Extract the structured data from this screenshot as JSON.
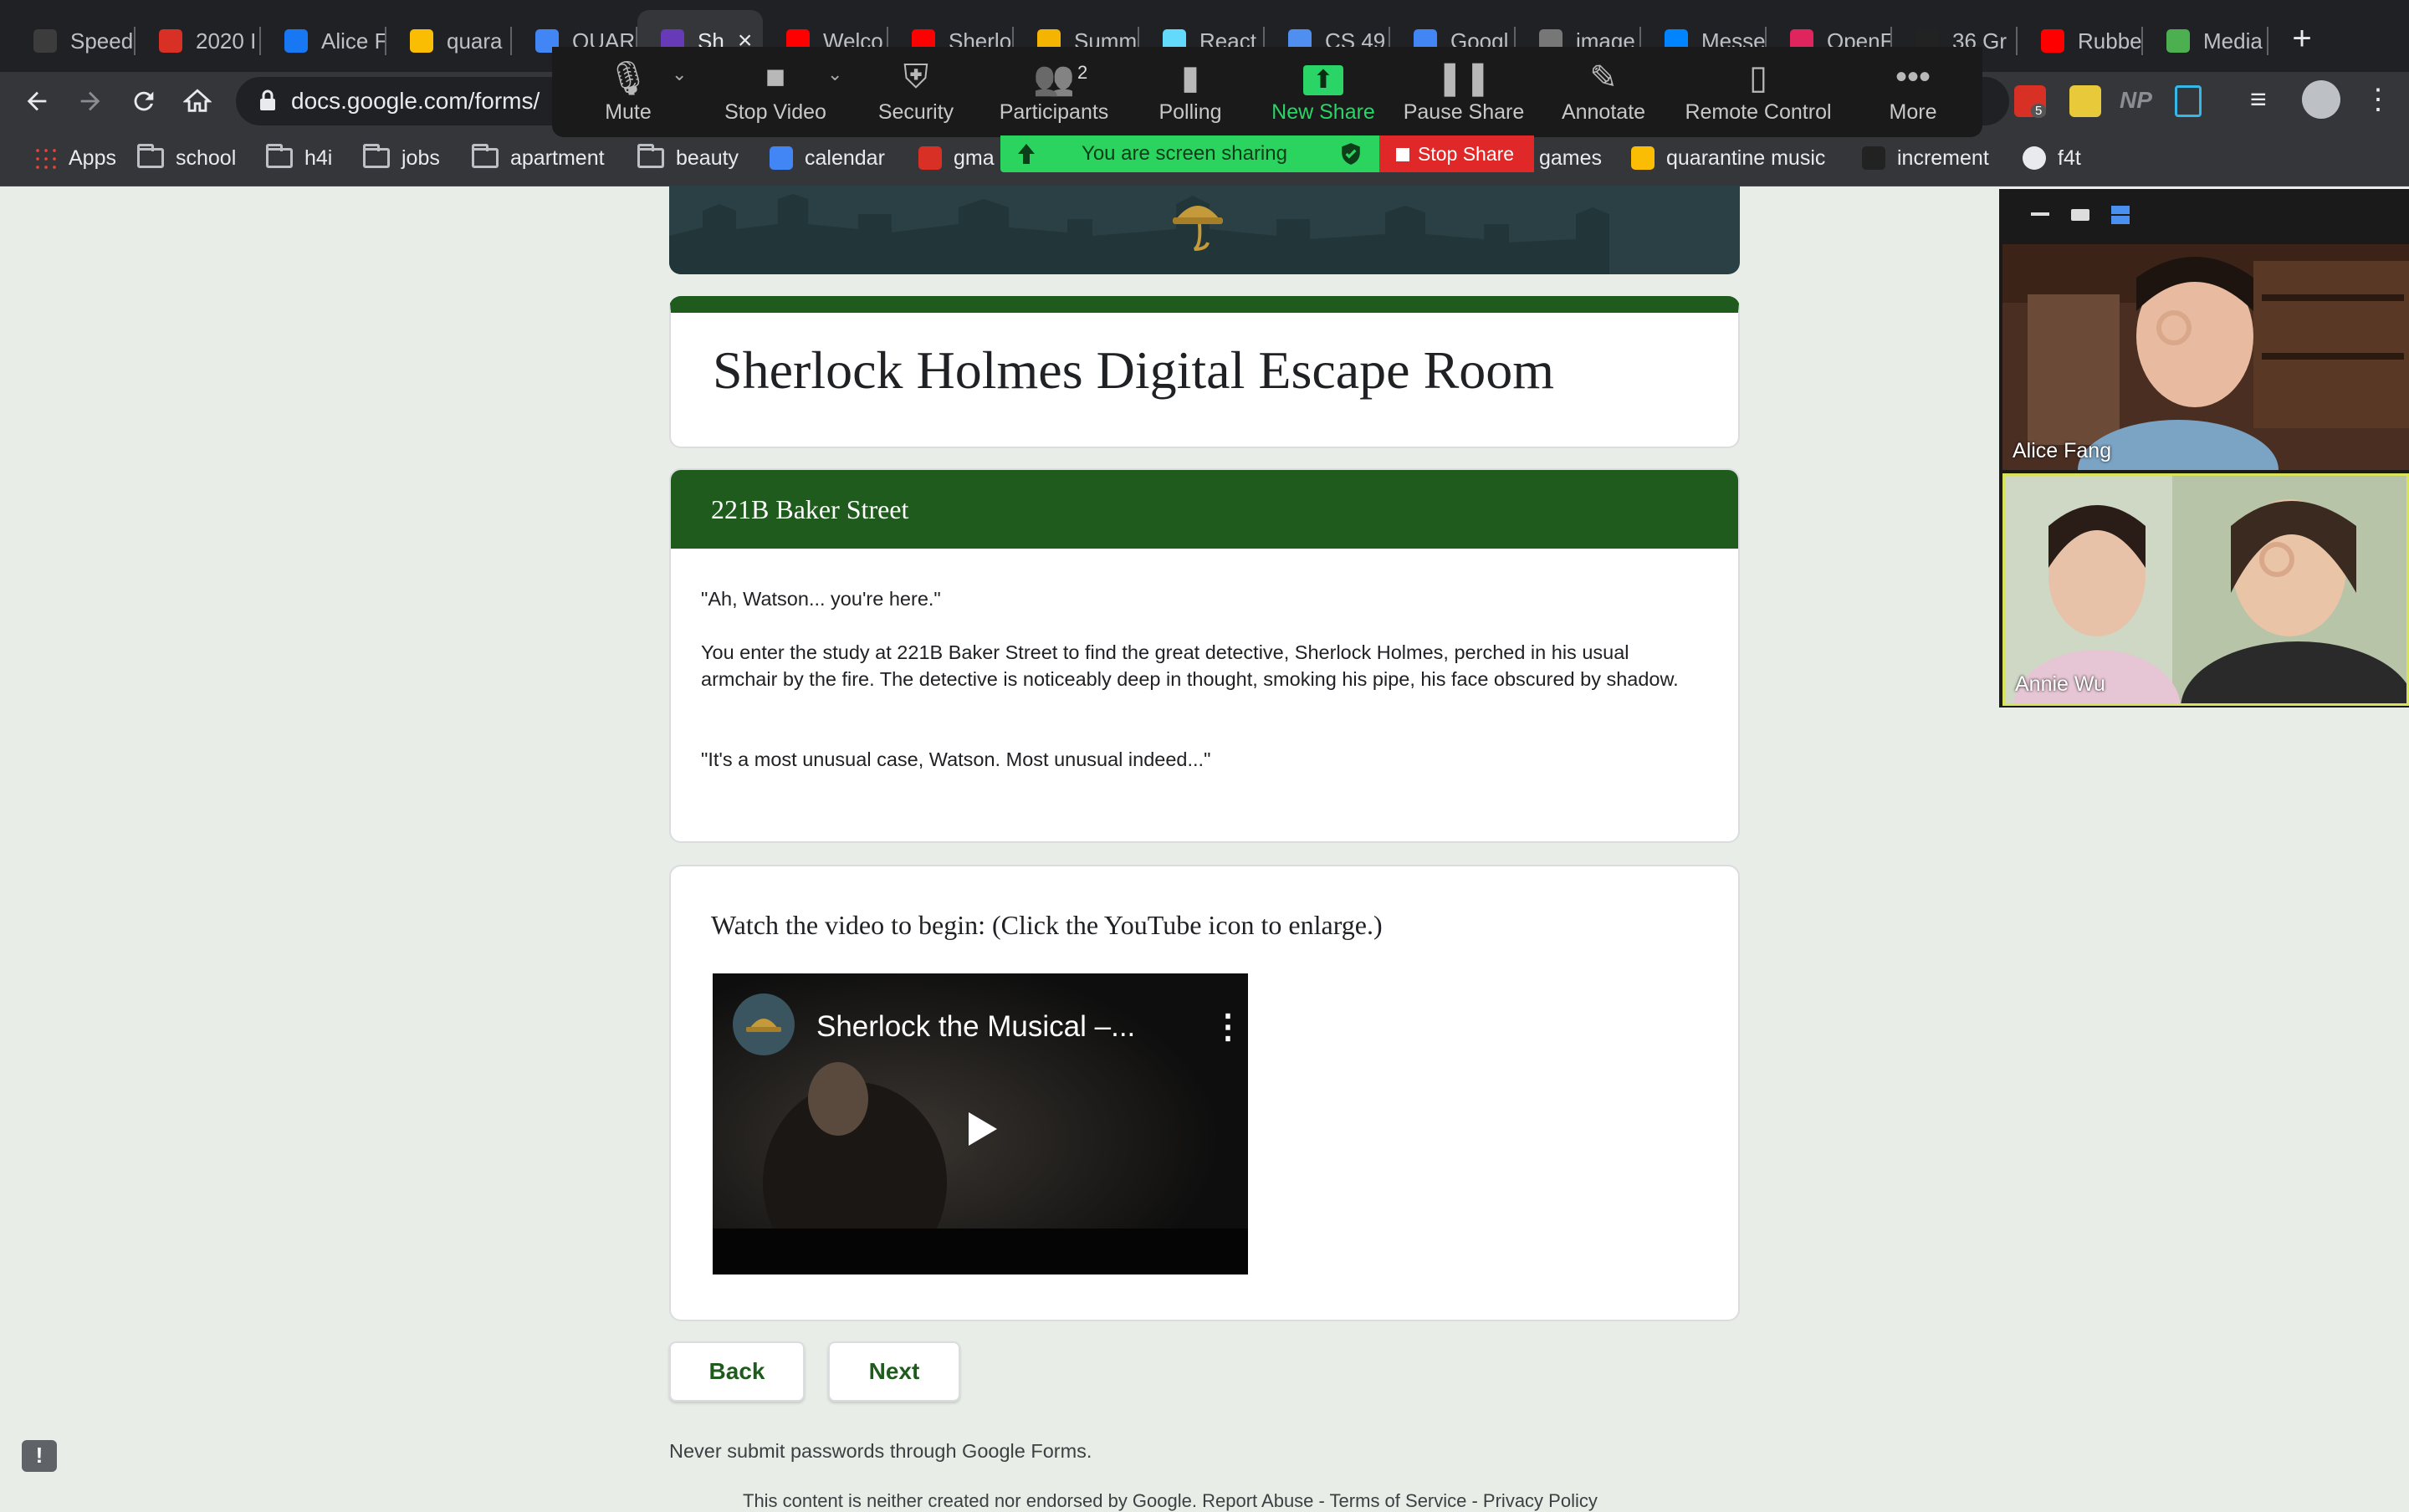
{
  "browser": {
    "tabs": [
      {
        "label": "Speed",
        "icon": "speedtest-icon",
        "color": "#3c3c3c"
      },
      {
        "label": "2020 I",
        "icon": "gmail-icon",
        "color": "#d93025"
      },
      {
        "label": "Alice F",
        "icon": "facebook-icon",
        "color": "#1877f2"
      },
      {
        "label": "quara",
        "icon": "drive-icon",
        "color": "#fbbc04"
      },
      {
        "label": "QUAR",
        "icon": "docs-icon",
        "color": "#4285f4"
      },
      {
        "label": "Sh",
        "icon": "forms-icon",
        "color": "#673ab7",
        "active": true
      },
      {
        "label": "Welco",
        "icon": "youtube-icon",
        "color": "#ff0000"
      },
      {
        "label": "Sherlo",
        "icon": "youtube-icon",
        "color": "#ff0000"
      },
      {
        "label": "Summ",
        "icon": "slides-icon",
        "color": "#f4b400"
      },
      {
        "label": "React",
        "icon": "react-icon",
        "color": "#61dafb"
      },
      {
        "label": "CS 49",
        "icon": "link-icon",
        "color": "#4f8ff0"
      },
      {
        "label": "Googl",
        "icon": "calendar-icon",
        "color": "#4285f4"
      },
      {
        "label": "image",
        "icon": "google-icon",
        "color": "#777777"
      },
      {
        "label": "Messe",
        "icon": "messenger-icon",
        "color": "#0084ff"
      },
      {
        "label": "OpenF",
        "icon": "openframeworks-icon",
        "color": "#e0245e"
      },
      {
        "label": "36 Gr",
        "icon": "lightning-icon",
        "color": "#222222"
      },
      {
        "label": "Rubbe",
        "icon": "youtube-icon",
        "color": "#ff0000"
      },
      {
        "label": "Media",
        "icon": "media-icon",
        "color": "#4caf50"
      }
    ],
    "close_tab": "×",
    "new_tab": "+",
    "url": "docs.google.com/forms/",
    "bookmarks": [
      {
        "label": "Apps",
        "type": "apps"
      },
      {
        "label": "school",
        "type": "folder"
      },
      {
        "label": "h4i",
        "type": "folder"
      },
      {
        "label": "jobs",
        "type": "folder"
      },
      {
        "label": "apartment",
        "type": "folder"
      },
      {
        "label": "beauty",
        "type": "folder"
      },
      {
        "label": "calendar",
        "type": "calendar"
      },
      {
        "label": "gma",
        "type": "gmail"
      },
      {
        "label": "games",
        "type": "hidden"
      },
      {
        "label": "quarantine music",
        "type": "drive"
      },
      {
        "label": "increment",
        "type": "site"
      },
      {
        "label": "f4t",
        "type": "github"
      }
    ],
    "extensions": {
      "badge": "5",
      "np": "NP"
    }
  },
  "zoom_toolbar": {
    "buttons": [
      {
        "label": "Mute",
        "icon": "microphone-icon"
      },
      {
        "label": "Stop Video",
        "icon": "video-camera-icon"
      },
      {
        "label": "Security",
        "icon": "shield-icon"
      },
      {
        "label": "Participants",
        "icon": "participants-icon",
        "count": "2"
      },
      {
        "label": "Polling",
        "icon": "bar-chart-icon"
      },
      {
        "label": "New Share",
        "icon": "share-arrow-icon"
      },
      {
        "label": "Pause Share",
        "icon": "pause-icon"
      },
      {
        "label": "Annotate",
        "icon": "pencil-icon"
      },
      {
        "label": "Remote Control",
        "icon": "mouse-icon"
      },
      {
        "label": "More",
        "icon": "more-dots-icon"
      }
    ],
    "sharing_status": "You are screen sharing",
    "stop_share": "Stop Share"
  },
  "form": {
    "title": "Sherlock Holmes Digital Escape Room",
    "section_title": "221B Baker Street",
    "paragraphs": [
      "\"Ah, Watson... you're here.\"",
      "You enter the study at 221B Baker Street to find the great detective, Sherlock Holmes, perched in his usual armchair by the fire. The detective is noticeably deep in thought, smoking his pipe, his face obscured by shadow.",
      "\"It's a most unusual case, Watson. Most unusual indeed...\""
    ],
    "video_prompt": "Watch the video to begin: (Click the YouTube icon to enlarge.)",
    "video_title": "Sherlock the Musical –...",
    "back": "Back",
    "next": "Next",
    "footer_note": "Never submit passwords through Google Forms.",
    "footer_links": "This content is neither created nor endorsed by Google. Report Abuse - Terms of Service - Privacy Policy",
    "theme_color": "#1e5b1d"
  },
  "participants": [
    {
      "name": "Alice Fang"
    },
    {
      "name": "Annie Wu"
    }
  ]
}
